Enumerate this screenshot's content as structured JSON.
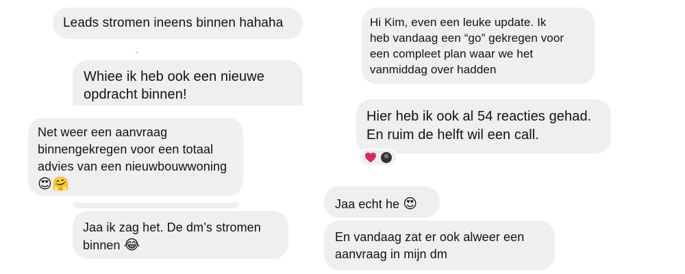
{
  "left_column": {
    "messages": [
      {
        "lines": [
          "Leads stromen ineens binnen hahaha"
        ]
      },
      {
        "lines": [
          "Whiee ik heb ook een nieuwe",
          "opdracht binnen!"
        ]
      },
      {
        "lines": [
          "Net weer een aanvraag",
          "binnengekregen voor een totaal",
          "advies van een nieuwbouwwoning"
        ],
        "emoji": "😍🤗"
      },
      {
        "lines": [
          "Jaa ik zag het. De dm’s stromen"
        ],
        "last_line": "binnen",
        "emoji": "😂"
      }
    ]
  },
  "right_column": {
    "messages": [
      {
        "lines": [
          "Hi Kim, even een leuke update. Ik",
          "heb vandaag een “go” gekregen voor",
          "een compleet plan waar we het",
          "vanmiddag over hadden"
        ]
      },
      {
        "lines": [
          "Hier heb ik ook al 54 reacties gehad.",
          "En ruim de helft wil een call."
        ],
        "reactions": {
          "heart_color": "#e0245e",
          "icons": [
            "heart-icon",
            "avatar"
          ]
        }
      },
      {
        "text": "Jaa echt he",
        "emoji": "😍"
      },
      {
        "lines": [
          "En vandaag zat er ook alweer een",
          "aanvraag in mijn dm"
        ]
      }
    ]
  },
  "colors": {
    "bubble_background": "#efeff1",
    "text": "#111111",
    "page_background": "#ffffff"
  }
}
